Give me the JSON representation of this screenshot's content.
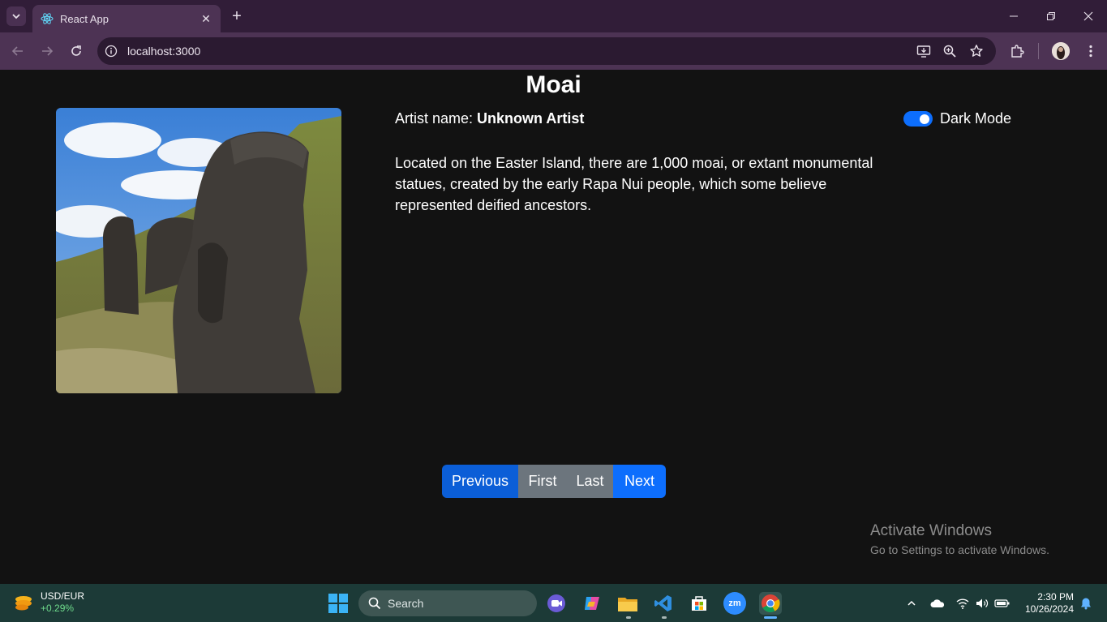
{
  "browser": {
    "tab_title": "React App",
    "url": "localhost:3000",
    "accent": "#311d38"
  },
  "artwork": {
    "title": "Moai",
    "artist_label": "Artist name:",
    "artist_name": "Unknown Artist",
    "description": "Located on the Easter Island, there are 1,000 moai, or extant monumental statues, created by the early Rapa Nui people, which some believe represented deified ancestors.",
    "image_icon": "moai-statues-photo"
  },
  "theme_toggle": {
    "label": "Dark Mode",
    "checked": true,
    "color": "#0d6efd"
  },
  "pagination": {
    "previous": "Previous",
    "first": "First",
    "last": "Last",
    "next": "Next"
  },
  "watermark": {
    "title": "Activate Windows",
    "subtitle": "Go to Settings to activate Windows."
  },
  "taskbar": {
    "widget_name": "USD/EUR",
    "widget_change": "+0.29%",
    "search_label": "Search",
    "time": "2:30 PM",
    "date": "10/26/2024"
  }
}
